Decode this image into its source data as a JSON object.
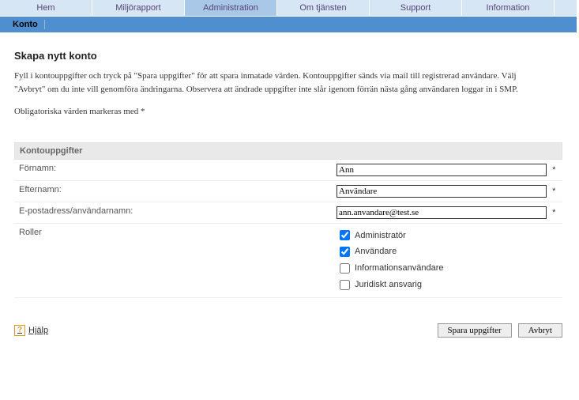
{
  "nav": {
    "items": [
      {
        "label": "Hem"
      },
      {
        "label": "Miljörapport"
      },
      {
        "label": "Administration"
      },
      {
        "label": "Om tjänsten"
      },
      {
        "label": "Support"
      },
      {
        "label": "Information"
      }
    ],
    "activeIndex": 2
  },
  "subnav": {
    "label": "Konto"
  },
  "page": {
    "title": "Skapa nytt konto",
    "intro1": "Fyll i kontouppgifter och tryck på \"Spara uppgifter\" för att spara inmatade värden. Kontouppgifter sänds via mail till registrerad användare. Välj \"Avbryt\" om du inte vill genomföra ändringarna. Observera att ändrade uppgifter inte slår igenom förrän nästa gång användaren loggar in i SMP.",
    "intro2": "Obligatoriska värden markeras med *"
  },
  "section": {
    "title": "Kontouppgifter"
  },
  "form": {
    "fornamn": {
      "label": "Förnamn:",
      "value": "Ann",
      "required": "*"
    },
    "efternamn": {
      "label": "Efternamn:",
      "value": "Användare",
      "required": "*"
    },
    "email": {
      "label": "E-postadress/användarnamn:",
      "value": "ann.anvandare@test.se",
      "required": "*"
    },
    "roller_label": "Roller",
    "roles": [
      {
        "label": "Administratör",
        "checked": true
      },
      {
        "label": "Användare",
        "checked": true
      },
      {
        "label": "Informationsanvändare",
        "checked": false
      },
      {
        "label": "Juridiskt ansvarig",
        "checked": false
      }
    ]
  },
  "footer": {
    "help": "Hjälp",
    "save": "Spara uppgifter",
    "cancel": "Avbryt"
  }
}
